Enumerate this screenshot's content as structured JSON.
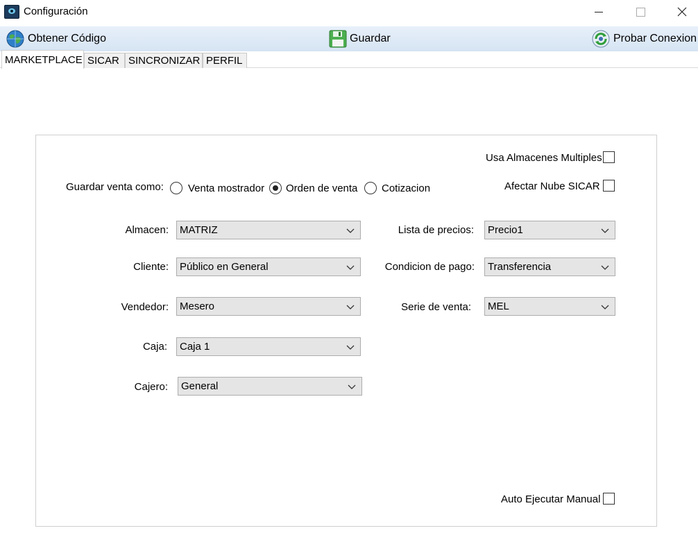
{
  "window": {
    "title": "Configuración"
  },
  "toolbar": {
    "obtener_label": "Obtener Código",
    "guardar_label": "Guardar",
    "probar_label": "Probar Conexion"
  },
  "tabs": [
    {
      "label": "MARKETPLACE",
      "active": true
    },
    {
      "label": "SICAR",
      "active": false
    },
    {
      "label": "SINCRONIZAR",
      "active": false
    },
    {
      "label": "PERFIL",
      "active": false
    }
  ],
  "form": {
    "usa_almacenes_label": "Usa Almacenes Multiples",
    "usa_almacenes_checked": false,
    "afectar_nube_label": "Afectar Nube SICAR",
    "afectar_nube_checked": false,
    "guardar_venta_label": "Guardar venta como:",
    "radio_options": [
      {
        "label": "Venta mostrador",
        "checked": false
      },
      {
        "label": "Orden de venta",
        "checked": true
      },
      {
        "label": "Cotizacion",
        "checked": false
      }
    ],
    "almacen": {
      "label": "Almacen:",
      "value": "MATRIZ"
    },
    "cliente": {
      "label": "Cliente:",
      "value": "Público en General"
    },
    "vendedor": {
      "label": "Vendedor:",
      "value": "Mesero"
    },
    "caja": {
      "label": "Caja:",
      "value": "Caja 1"
    },
    "cajero": {
      "label": "Cajero:",
      "value": "General"
    },
    "lista_precios": {
      "label": "Lista de precios:",
      "value": "Precio1"
    },
    "condicion_pago": {
      "label": "Condicion de pago:",
      "value": "Transferencia"
    },
    "serie_venta": {
      "label": "Serie de venta:",
      "value": "MEL"
    },
    "auto_ejecutar_label": "Auto Ejecutar Manual",
    "auto_ejecutar_checked": false
  },
  "icons": {
    "app": "sicar-app-icon",
    "obtener": "globe-icon",
    "guardar": "floppy-disk-icon",
    "probar": "refresh-connection-icon",
    "dropdown": "chevron-down-icon"
  },
  "colors": {
    "toolbar_bg": "#dce8f5",
    "select_bg": "#e5e5e5",
    "save_icon": "#4caf50"
  }
}
